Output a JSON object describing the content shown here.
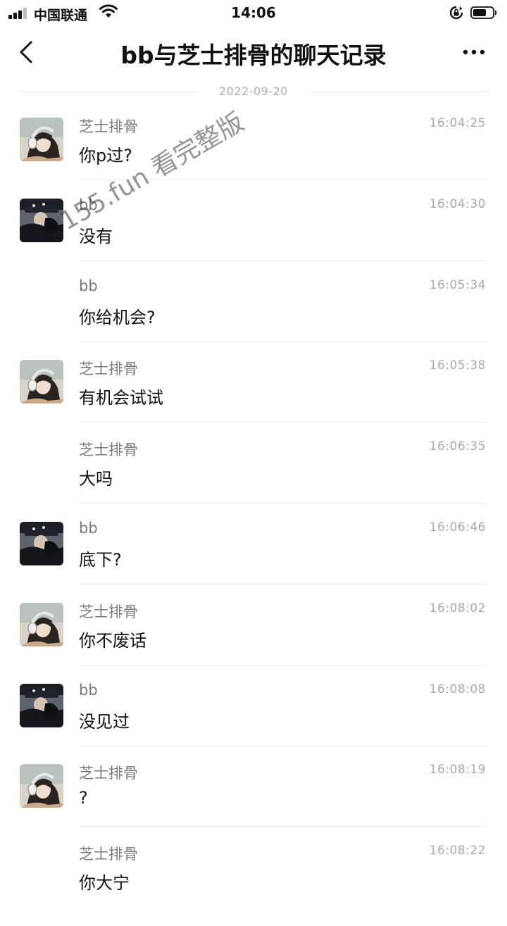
{
  "status_bar": {
    "carrier": "中国联通",
    "time": "14:06"
  },
  "nav": {
    "title": "bb与芝士排骨的聊天记录"
  },
  "date_divider": "2022-09-20",
  "watermark": "155.fun 看完整版",
  "messages": [
    {
      "sender": "芝士排骨",
      "time": "16:04:25",
      "text": "你p过?",
      "avatar": "girl-headphones"
    },
    {
      "sender": "bb",
      "time": "16:04:30",
      "text": "没有",
      "avatar": "dark-cap"
    },
    {
      "sender": "bb",
      "time": "16:05:34",
      "text": "你给机会?",
      "avatar": ""
    },
    {
      "sender": "芝士排骨",
      "time": "16:05:38",
      "text": "有机会试试",
      "avatar": "girl-headphones"
    },
    {
      "sender": "芝士排骨",
      "time": "16:06:35",
      "text": "大吗",
      "avatar": ""
    },
    {
      "sender": "bb",
      "time": "16:06:46",
      "text": "底下?",
      "avatar": "dark-cap"
    },
    {
      "sender": "芝士排骨",
      "time": "16:08:02",
      "text": "你不废话",
      "avatar": "girl-headphones"
    },
    {
      "sender": "bb",
      "time": "16:08:08",
      "text": "没见过",
      "avatar": "dark-cap"
    },
    {
      "sender": "芝士排骨",
      "time": "16:08:19",
      "text": "?",
      "avatar": "girl-headphones"
    },
    {
      "sender": "芝士排骨",
      "time": "16:08:22",
      "text": "你大宁",
      "avatar": ""
    }
  ]
}
